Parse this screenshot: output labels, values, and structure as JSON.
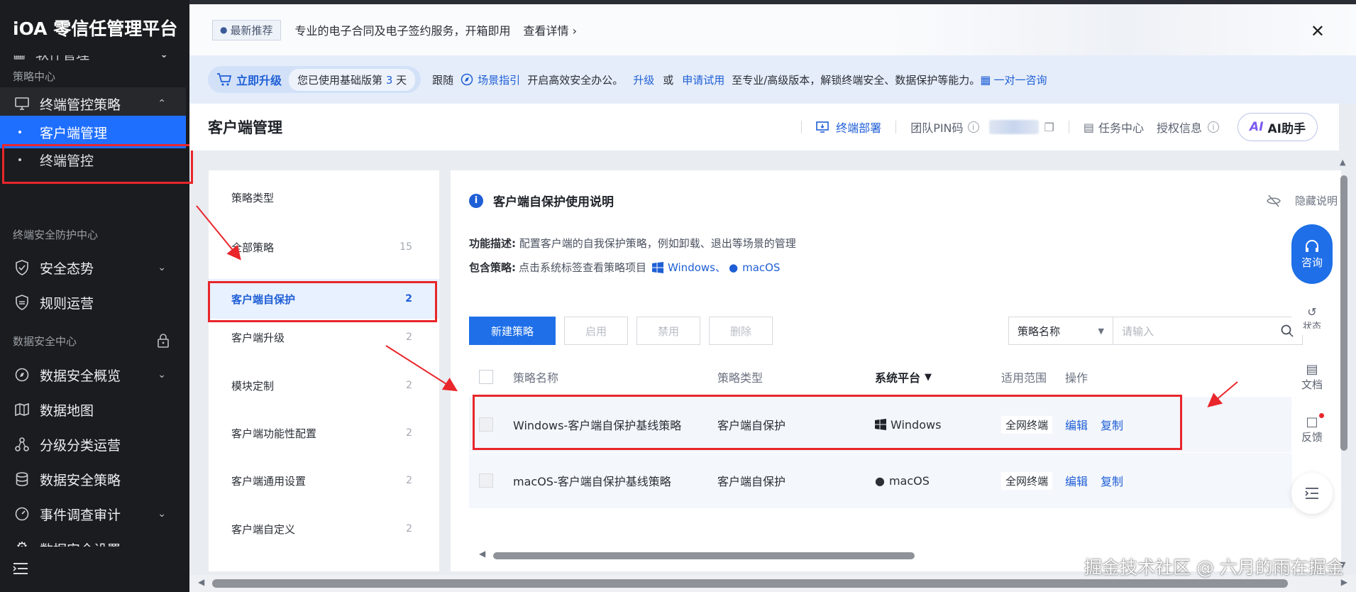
{
  "sidebar": {
    "brand": "iOA 零信任管理平台",
    "partial_top": "软件管理",
    "section_policy": "策略中心",
    "terminal_policy": "终端管控策略",
    "client_mgmt": "客户端管理",
    "terminal_control": "终端管控",
    "section_terminal_security": "终端安全防护中心",
    "security_posture": "安全态势",
    "rule_ops": "规则运营",
    "section_data_security": "数据安全中心",
    "data_overview": "数据安全概览",
    "data_map": "数据地图",
    "classify_ops": "分级分类运营",
    "data_policy": "数据安全策略",
    "event_audit": "事件调查审计",
    "partial_bottom": "数据安全设置"
  },
  "banner": {
    "tag": "最新推荐",
    "text": "专业的电子合同及电子签约服务，开箱即用",
    "link": "查看详情"
  },
  "upgrade": {
    "button": "立即升级",
    "days_prefix": "您已使用基础版第",
    "days": "3",
    "days_suffix": "天",
    "follow": "跟随",
    "scene_guide": "场景指引",
    "text1": "开启高效安全办公。",
    "upgrade_link": "升级",
    "or": "或",
    "trial_link": "申请试用",
    "text2": "至专业/高级版本，解锁终端安全、数据保护等能力。",
    "consult_link": "一对一咨询"
  },
  "header": {
    "title": "客户端管理",
    "deploy": "终端部署",
    "team_pin": "团队PIN码",
    "task_center": "任务中心",
    "license": "授权信息",
    "ai": "AI助手"
  },
  "policy_types": {
    "title": "策略类型",
    "items": [
      {
        "label": "全部策略",
        "count": "15"
      },
      {
        "label": "客户端自保护",
        "count": "2"
      },
      {
        "label": "客户端升级",
        "count": "2"
      },
      {
        "label": "模块定制",
        "count": "2"
      },
      {
        "label": "客户端功能性配置",
        "count": "2"
      },
      {
        "label": "客户端通用设置",
        "count": "2"
      },
      {
        "label": "客户端自定义",
        "count": "2"
      }
    ]
  },
  "main": {
    "info_title": "客户端自保护使用说明",
    "hide_note": "隐藏说明",
    "desc_label": "功能描述:",
    "desc_text": "配置客户端的自我保护策略，例如卸载、退出等场景的管理",
    "include_label": "包含策略:",
    "include_text": "点击系统标签查看策略项目",
    "os_windows": "Windows、",
    "os_macos": "macOS",
    "new_button": "新建策略",
    "enable_button": "启用",
    "disable_button": "禁用",
    "delete_button": "删除",
    "select_value": "策略名称",
    "search_placeholder": "请输入"
  },
  "table": {
    "headers": {
      "name": "策略名称",
      "type": "策略类型",
      "platform": "系统平台",
      "scope": "适用范围",
      "ops": "操作"
    },
    "rows": [
      {
        "name": "Windows-客户端自保护基线策略",
        "type": "客户端自保护",
        "platform": "Windows",
        "scope": "全网终端",
        "edit": "编辑",
        "copy": "复制"
      },
      {
        "name": "macOS-客户端自保护基线策略",
        "type": "客户端自保护",
        "platform": "macOS",
        "scope": "全网终端",
        "edit": "编辑",
        "copy": "复制"
      }
    ]
  },
  "float_tools": {
    "consult": "咨询",
    "status": "状态",
    "docs": "文档",
    "feedback": "反馈"
  },
  "watermark": "掘金技术社区 @ 六月的雨在掘金",
  "colors": {
    "primary": "#1f6fe8",
    "sidebar_bg": "#1b1c1f",
    "annotation_red": "#e8262b"
  }
}
